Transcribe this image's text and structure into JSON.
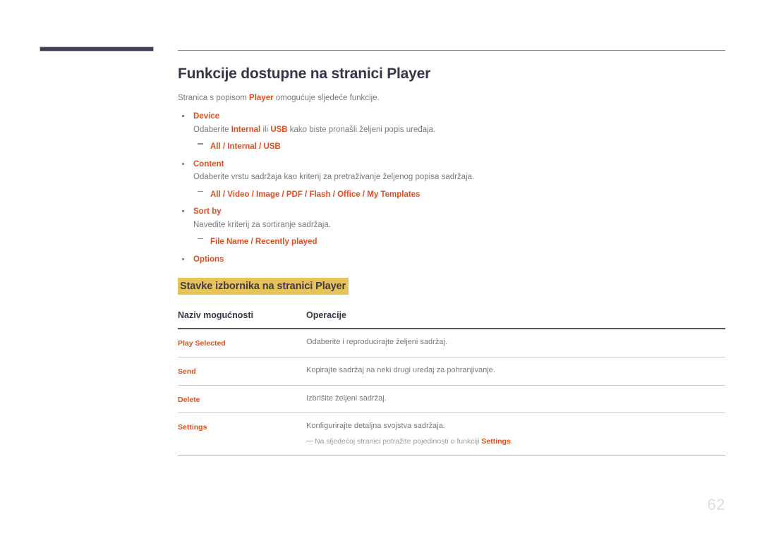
{
  "document": {
    "page_number": "62",
    "title": "Funkcije dostupne na stranici Player",
    "intro": {
      "before": "Stranica s popisom ",
      "accent": "Player",
      "after": " omogućuje sljedeće funkcije."
    }
  },
  "features": [
    {
      "name": "Device",
      "description_parts": [
        {
          "text": "Odaberite ",
          "accent": false
        },
        {
          "text": "Internal",
          "accent": true
        },
        {
          "text": " ili ",
          "accent": false
        },
        {
          "text": "USB",
          "accent": true
        },
        {
          "text": " kako biste pronašli željeni popis uređaja.",
          "accent": false
        }
      ],
      "options": [
        "All",
        "Internal",
        "USB"
      ]
    },
    {
      "name": "Content",
      "description_parts": [
        {
          "text": "Odaberite vrstu sadržaja kao kriterij za pretraživanje željenog popisa sadržaja.",
          "accent": false
        }
      ],
      "options": [
        "All",
        "Video",
        "Image",
        "PDF",
        "Flash",
        "Office",
        "My Templates"
      ]
    },
    {
      "name": "Sort by",
      "description_parts": [
        {
          "text": "Navedite kriterij za sortiranje sadržaja.",
          "accent": false
        }
      ],
      "options": [
        "File Name",
        "Recently played"
      ]
    },
    {
      "name": "Options",
      "description_parts": [],
      "options": []
    }
  ],
  "section": {
    "highlighted_heading": "Stavke izbornika na stranici Player"
  },
  "table": {
    "headers": [
      "Naziv mogućnosti",
      "Operacije"
    ],
    "rows": [
      {
        "name": "Play Selected",
        "operation": "Odaberite i reproducirajte željeni sadržaj.",
        "note": null
      },
      {
        "name": "Send",
        "operation": "Kopirajte sadržaj na neki drugi uređaj za pohranjivanje.",
        "note": null
      },
      {
        "name": "Delete",
        "operation": "Izbrišite željeni sadržaj.",
        "note": null
      },
      {
        "name": "Settings",
        "operation": "Konfigurirajte detaljna svojstva sadržaja.",
        "note": {
          "before": "Na sljedećoj stranici potražite pojedinosti o funkciji ",
          "accent": "Settings",
          "after": "."
        }
      }
    ]
  },
  "colors": {
    "accent": "#e04e1f",
    "highlight": "#e7c257",
    "title": "#3b3347",
    "body": "#7a7a7a",
    "navy_bar": "#403f55",
    "page_number": "#dcdde2"
  }
}
